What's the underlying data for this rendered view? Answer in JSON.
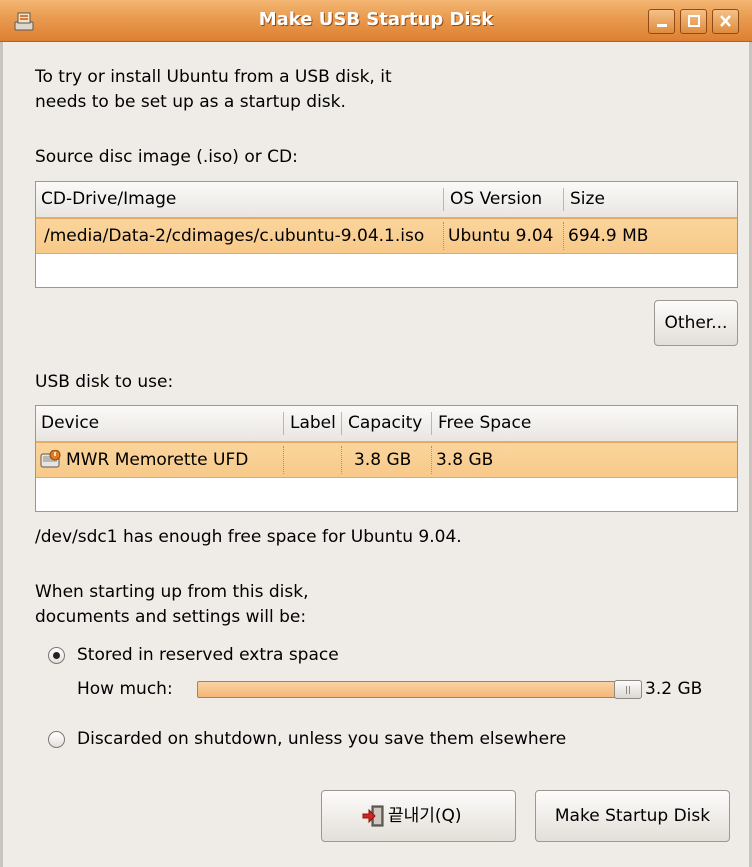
{
  "window": {
    "title": "Make USB Startup Disk",
    "accent": "#e99a4f"
  },
  "intro": {
    "line1": "To try or install Ubuntu from a USB disk, it",
    "line2": "needs to be set up as a startup disk."
  },
  "source": {
    "label": "Source disc image (.iso) or CD:",
    "columns": [
      "CD-Drive/Image",
      "OS Version",
      "Size"
    ],
    "rows": [
      {
        "image": "/media/Data-2/cdimages/c.ubuntu-9.04.1.iso",
        "os_version": "Ubuntu 9.04",
        "size": "694.9 MB"
      }
    ],
    "other_button": "Other..."
  },
  "usb": {
    "label": "USB disk to use:",
    "columns": [
      "Device",
      "Label",
      "Capacity",
      "Free Space"
    ],
    "rows": [
      {
        "device": "MWR Memorette UFD",
        "label": "",
        "capacity": "3.8 GB",
        "free_space": "3.8 GB",
        "icon": "usb-drive-icon"
      }
    ]
  },
  "status": "/dev/sdc1 has enough free space for Ubuntu 9.04.",
  "persistence": {
    "line1": "When starting up from this disk,",
    "line2": "documents and settings will be:",
    "option_stored": "Stored in reserved extra space",
    "how_much_label": "How much:",
    "how_much_value": "3.2 GB",
    "slider_fraction": 0.84,
    "option_discarded": "Discarded on shutdown, unless you save them elsewhere",
    "selected": "stored"
  },
  "buttons": {
    "quit": "끝내기(Q)",
    "make": "Make Startup Disk"
  }
}
